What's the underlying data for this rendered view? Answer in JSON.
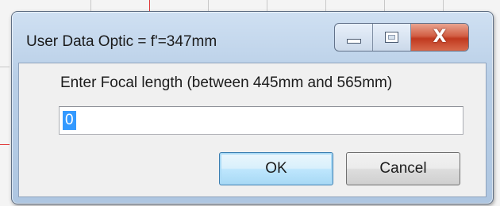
{
  "window": {
    "title": "User Data Optic = f'=347mm"
  },
  "caption_buttons": {
    "minimize_icon": "minimize-icon",
    "maximize_icon": "maximize-icon",
    "close_glyph": "X"
  },
  "dialog": {
    "prompt": "Enter Focal length (between 445mm and 565mm)",
    "input_value": "0",
    "ok_label": "OK",
    "cancel_label": "Cancel"
  },
  "colors": {
    "selection": "#3399ff",
    "close_button": "#c8452c",
    "titlebar": "#b9cfe7"
  }
}
